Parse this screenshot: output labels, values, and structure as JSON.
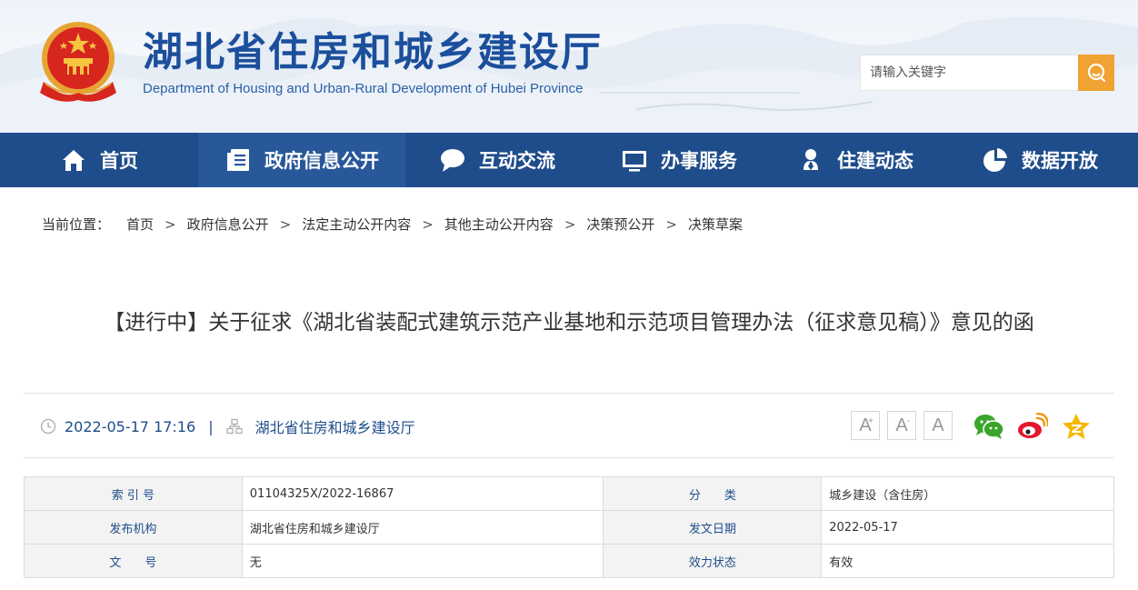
{
  "header": {
    "title": "湖北省住房和城乡建设厅",
    "subtitle": "Department of Housing and Urban-Rural Development of Hubei Province",
    "search_placeholder": "请输入关键字"
  },
  "nav": {
    "items": [
      {
        "label": "首页",
        "icon": "home-icon"
      },
      {
        "label": "政府信息公开",
        "icon": "document-list-icon"
      },
      {
        "label": "互动交流",
        "icon": "chat-bubble-icon"
      },
      {
        "label": "办事服务",
        "icon": "monitor-icon"
      },
      {
        "label": "住建动态",
        "icon": "person-pin-icon"
      },
      {
        "label": "数据开放",
        "icon": "pie-chart-icon"
      }
    ],
    "active_index": 1
  },
  "breadcrumb": {
    "label": "当前位置：",
    "items": [
      "首页",
      "政府信息公开",
      "法定主动公开内容",
      "其他主动公开内容",
      "决策预公开",
      "决策草案"
    ],
    "separator": ">"
  },
  "article": {
    "title": "【进行中】关于征求《湖北省装配式建筑示范产业基地和示范项目管理办法（征求意见稿）》意见的函",
    "datetime": "2022-05-17 17:16",
    "meta_separator": "|",
    "publisher": "湖北省住房和城乡建设厅"
  },
  "font_size_buttons": {
    "increase": "A",
    "increase_sup": "+",
    "decrease": "A",
    "decrease_sup": "-",
    "reset": "A"
  },
  "share": {
    "icons": [
      "wechat-icon",
      "weibo-icon",
      "qzone-icon"
    ]
  },
  "info": {
    "rows": [
      {
        "label1": "索 引 号",
        "value1": "01104325X/2022-16867",
        "label2": "分　　类",
        "value2": "城乡建设（含住房）"
      },
      {
        "label1": "发布机构",
        "value1": "湖北省住房和城乡建设厅",
        "label2": "发文日期",
        "value2": "2022-05-17"
      },
      {
        "label1": "文　　号",
        "value1": "无",
        "label2": "效力状态",
        "value2": "有效"
      }
    ]
  },
  "colors": {
    "brand_blue": "#1f4d8b",
    "nav_active": "#28589a",
    "search_button": "#f0a232",
    "title_blue": "#1b4f9c"
  }
}
